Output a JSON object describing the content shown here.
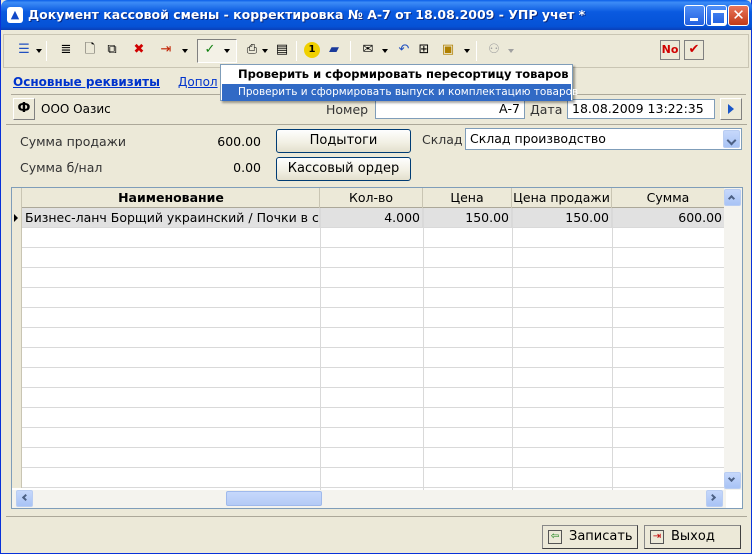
{
  "window": {
    "title": "Документ кассовой смены - корректировка № А-7 от 18.08.2009 - УПР учет *",
    "icon": "1c-icon"
  },
  "menu": {
    "items": [
      {
        "label": "Проверить и сформировать пересортицу товаров"
      },
      {
        "label": "Проверить и сформировать выпуск и комплектацию товаров"
      }
    ]
  },
  "tabs": {
    "main": "Основные реквизиты",
    "extra": "Допол"
  },
  "header": {
    "org_button": "Ф",
    "org_name": "ООО Оазис",
    "number_label": "Номер",
    "number_value": "А-7",
    "date_label": "Дата",
    "date_value": "18.08.2009 13:22:35"
  },
  "summary": {
    "sale_label": "Сумма продажи",
    "sale_value": "600.00",
    "cashless_label": "Сумма б/нал",
    "cashless_value": "0.00",
    "subtotals_button": "Подытоги",
    "cash_order_button": "Кассовый ордер",
    "warehouse_label": "Склад",
    "warehouse_value": "Склад производство"
  },
  "table": {
    "columns": [
      "Наименование",
      "Кол-во",
      "Цена",
      "Цена продажи",
      "Сумма"
    ],
    "rows": [
      [
        "Бизнес-ланч Борщий украинский / Почки в сме",
        "4.000",
        "150.00",
        "150.00",
        "600.00"
      ]
    ]
  },
  "footer": {
    "save_button": "Записать",
    "exit_button": "Выход"
  }
}
